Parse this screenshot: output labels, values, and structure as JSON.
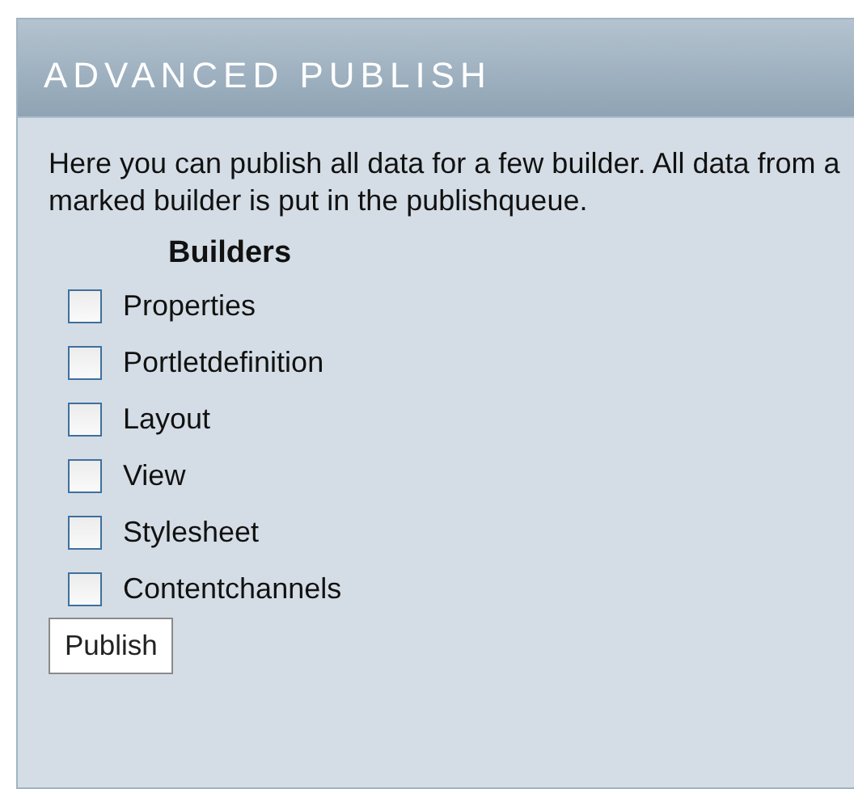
{
  "panel": {
    "title": "ADVANCED PUBLISH",
    "description": "Here you can publish all data for a few builder. All data from a marked builder is put in the publishqueue.",
    "builders_heading": "Builders",
    "builders": [
      {
        "label": "Properties",
        "checked": false
      },
      {
        "label": "Portletdefinition",
        "checked": false
      },
      {
        "label": "Layout",
        "checked": false
      },
      {
        "label": "View",
        "checked": false
      },
      {
        "label": "Stylesheet",
        "checked": false
      },
      {
        "label": "Contentchannels",
        "checked": false
      }
    ],
    "button": "Publish"
  }
}
